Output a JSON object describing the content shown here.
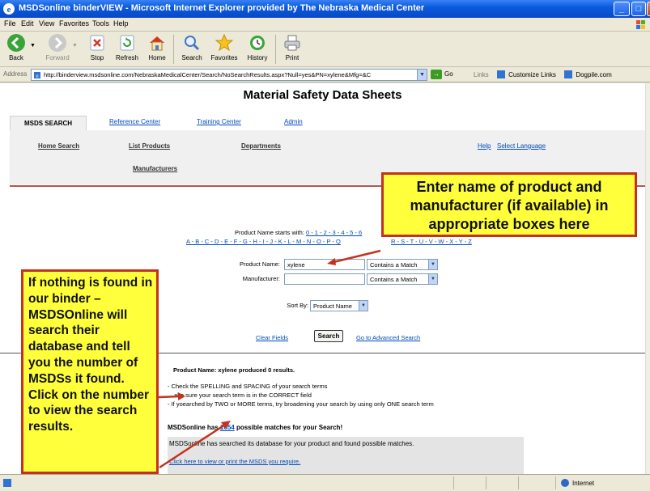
{
  "window": {
    "title": "MSDSonline binderVIEW - Microsoft Internet Explorer provided by The Nebraska Medical Center"
  },
  "menu": [
    "File",
    "Edit",
    "View",
    "Favorites",
    "Tools",
    "Help"
  ],
  "toolbar": {
    "back": "Back",
    "forward": "Forward",
    "stop": "Stop",
    "refresh": "Refresh",
    "home": "Home",
    "search": "Search",
    "favorites": "Favorites",
    "history": "History",
    "print": "Print"
  },
  "address": {
    "label": "Address",
    "url": "http://binderview.msdsonline.com/NebraskaMedicalCenter/Search/NoSearchResults.aspx?Null=yes&PN=xylene&Mfg=&C",
    "go": "Go",
    "links_label": "Links",
    "link1": "Customize Links",
    "link2": "Dogpile.com"
  },
  "page": {
    "title": "Material Safety Data Sheets",
    "tabs": [
      "MSDS SEARCH",
      "Reference Center",
      "Training Center",
      "Admin"
    ],
    "subnav": {
      "home_search": "Home Search",
      "list_products": "List Products",
      "departments": "Departments",
      "manufacturers": "Manufacturers",
      "help": "Help",
      "select_language": "Select Language"
    },
    "starts_with_label": "Product Name starts with:",
    "starts_with_digits": "0 - 1 - 2 - 3 - 4 - 5 - 6",
    "letters_row": "A - B - C - D - E - F - G - H - I - J - K - L - M - N - O - P - Q",
    "letters_row_end": "R - S - T - U - V - W - X - Y - Z",
    "form": {
      "product_label": "Product Name:",
      "product_value": "xylene",
      "manufacturer_label": "Manufacturer:",
      "manufacturer_value": "",
      "match1": "Contains a Match",
      "match2": "Contains a Match",
      "sort_label": "Sort By:",
      "sort_value": "Product Name",
      "clear": "Clear Fields",
      "search": "Search",
      "advanced": "Go to Advanced Search"
    },
    "results": {
      "produced_prefix": "Product Name: xylene produced",
      "produced_count": "0",
      "produced_suffix": "results.",
      "tip1": "- Check the SPELLING and SPACING of your search terms",
      "tip2": "ake sure your search term is in the CORRECT field",
      "tip3": "earched by TWO or MORE terms, try broadening your search by using only ONE search term",
      "tip3_prefix": "- If yo",
      "matches_prefix": "MSDSonline has",
      "matches_count": "1654",
      "matches_suffix": "possible matches for your Search!",
      "searched_text": "MSDSonline has searched its database for your product and found possible matches.",
      "click_link": "Click here to view or print the MSDS you require."
    }
  },
  "callouts": {
    "top": "Enter name of product and manufacturer (if available) in appropriate boxes here",
    "left": "If nothing is found in our binder – MSDSOnline will search their database and tell you the number of MSDSs it found.  Click on the number to view the search results."
  },
  "status": {
    "zone": "Internet"
  }
}
